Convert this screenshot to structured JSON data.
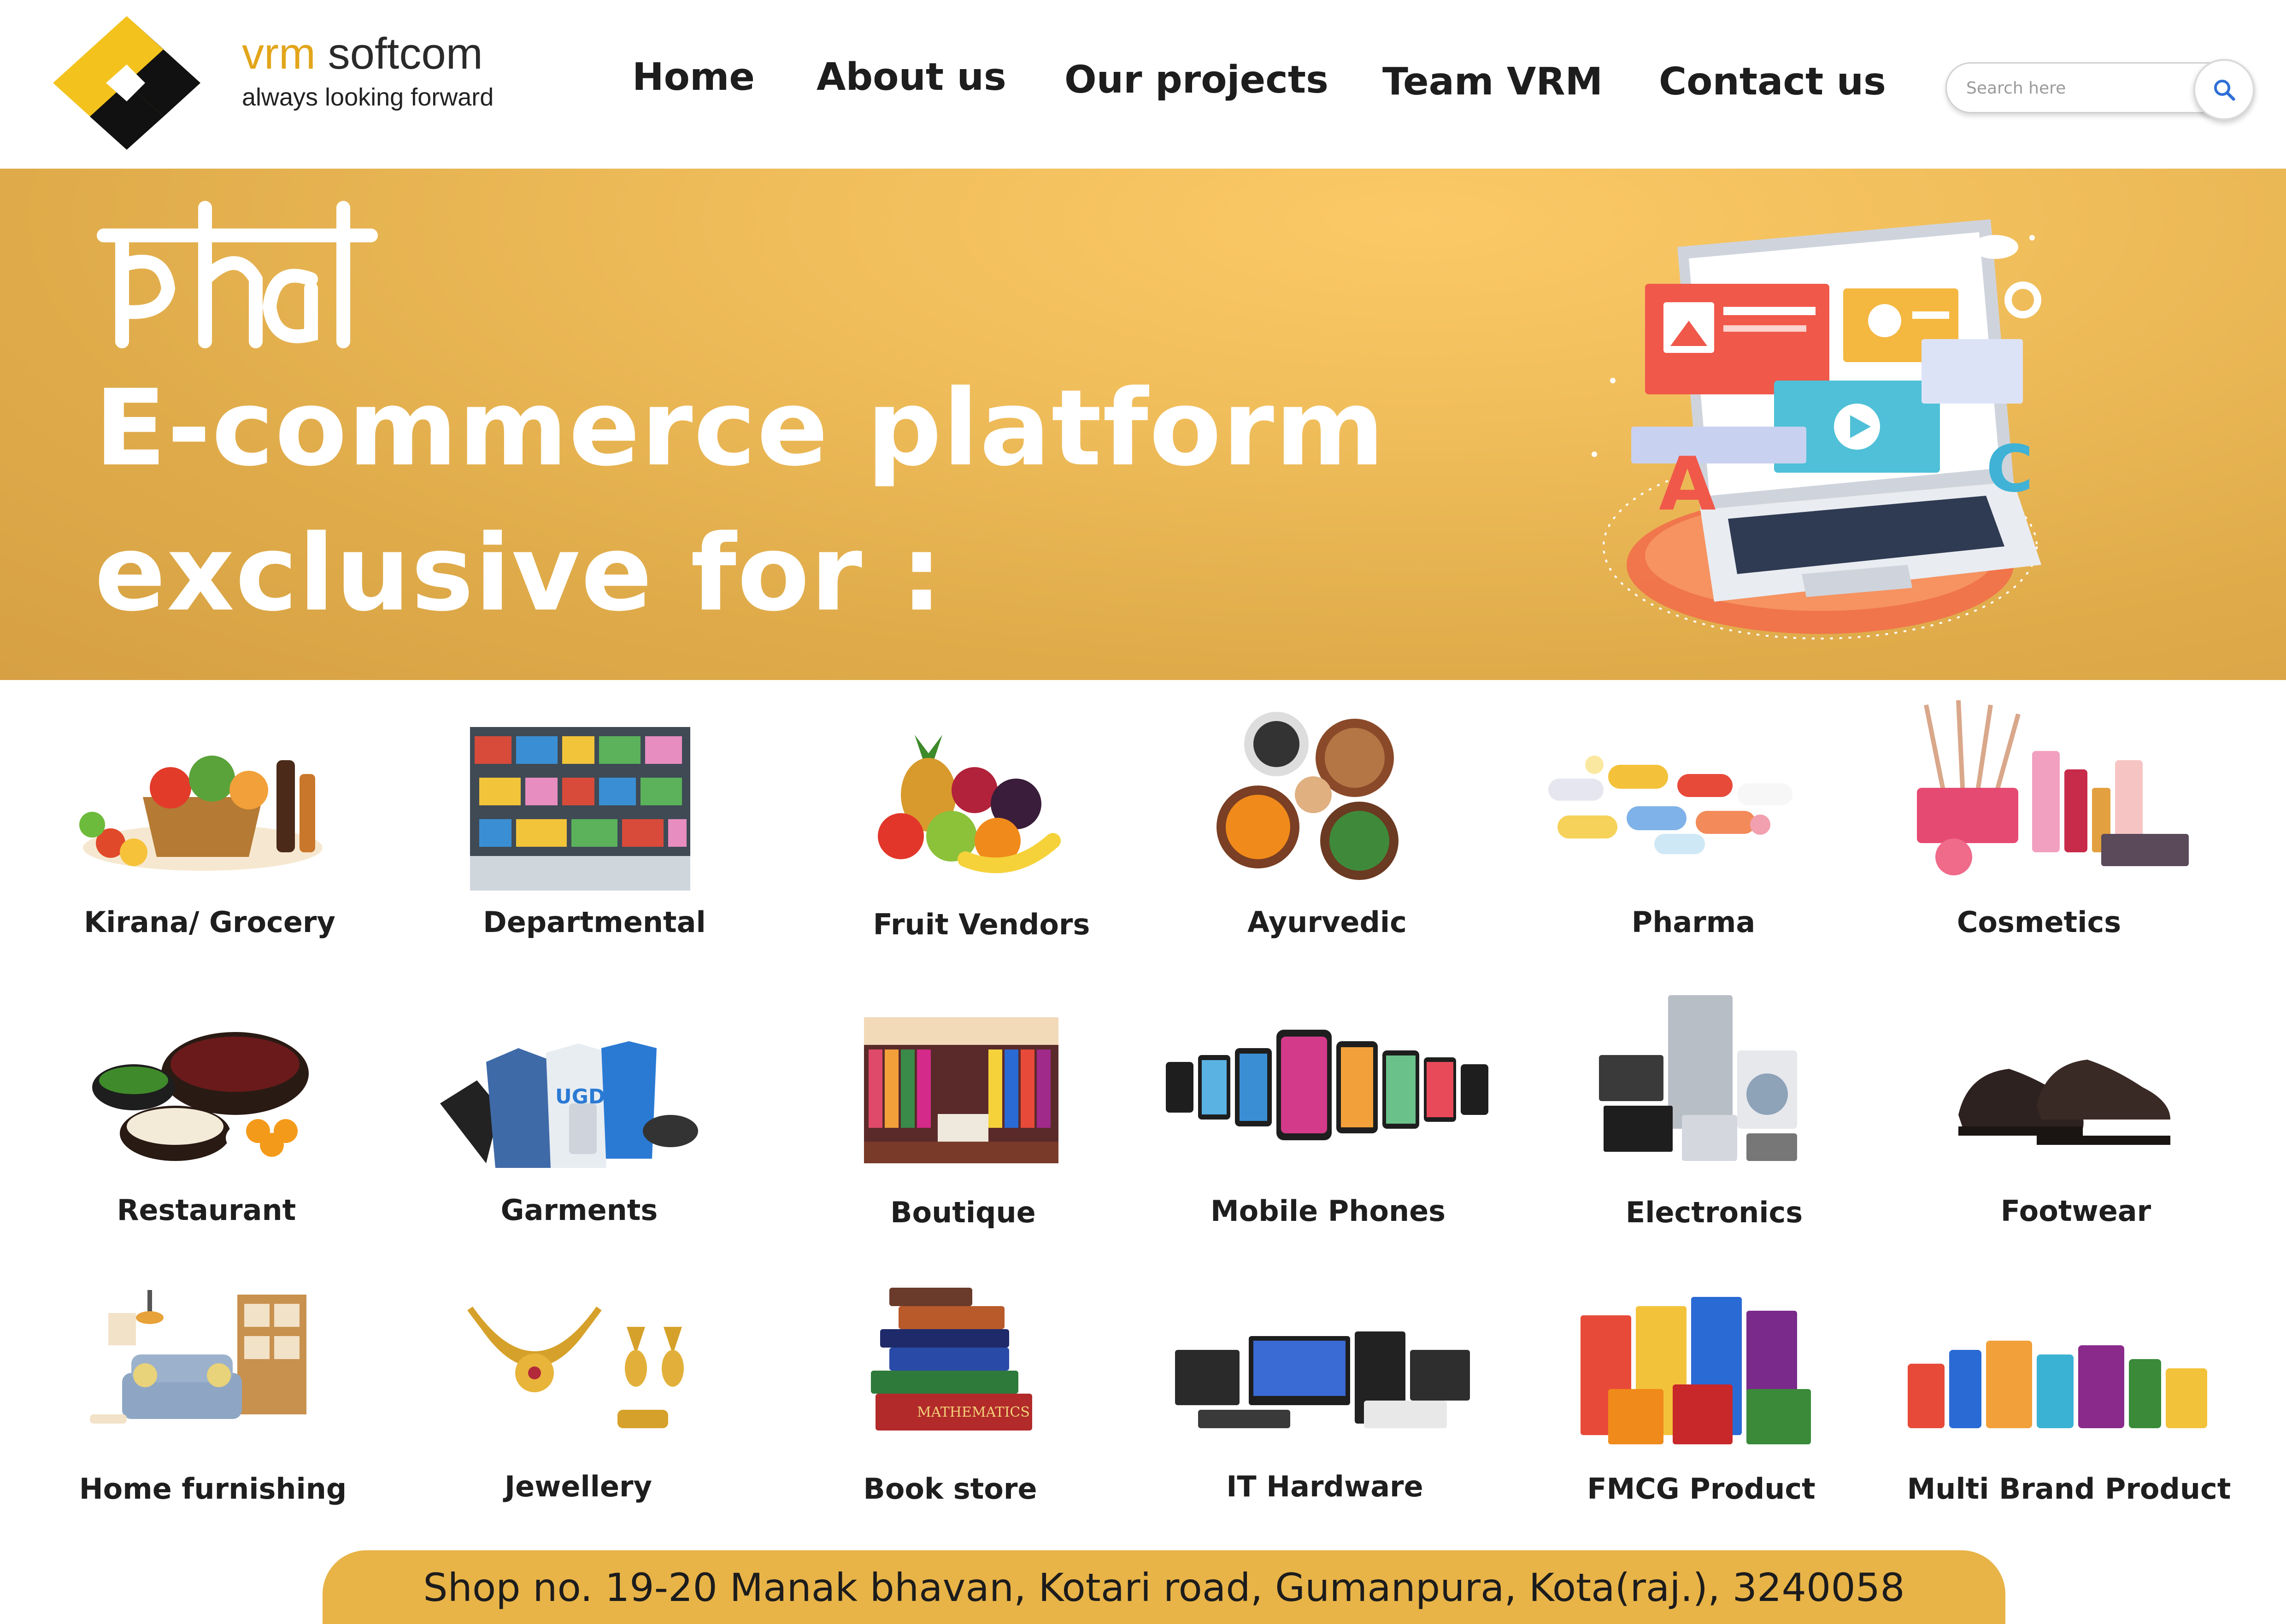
{
  "header": {
    "brand_vrm": "vrm",
    "brand_soft": " softcom",
    "tagline": "always looking forward",
    "logo_colors": [
      "#f3c21d",
      "#111111"
    ],
    "nav": [
      "Home",
      "About us",
      "Our projects",
      "Team VRM",
      "Contact us"
    ],
    "search_placeholder": "Search here",
    "search_icon": "magnifier-icon",
    "accent_color": "#e2a51a"
  },
  "banner": {
    "logo_text": "pehal",
    "line1": "E-commerce platform",
    "line2": "exclusive for :",
    "background_color": "#e2ae4e",
    "illustration": "laptop-ecommerce-illustration"
  },
  "categories": [
    {
      "label": "Kirana/ Grocery",
      "image": "grocery-basket"
    },
    {
      "label": "Departmental",
      "image": "store-shelves"
    },
    {
      "label": "Fruit Vendors",
      "image": "fruit-pile"
    },
    {
      "label": "Ayurvedic",
      "image": "spice-bowls"
    },
    {
      "label": "Pharma",
      "image": "pills"
    },
    {
      "label": "Cosmetics",
      "image": "makeup-set"
    },
    {
      "label": "Restaurant",
      "image": "food-bowls"
    },
    {
      "label": "Garments",
      "image": "apparel-merch"
    },
    {
      "label": "Boutique",
      "image": "boutique-interior"
    },
    {
      "label": "Mobile Phones",
      "image": "smartphones-row"
    },
    {
      "label": "Electronics",
      "image": "home-appliances"
    },
    {
      "label": "Footwear",
      "image": "leather-shoes"
    },
    {
      "label": "Home furnishing",
      "image": "sofa-room"
    },
    {
      "label": "Jewellery",
      "image": "gold-necklace"
    },
    {
      "label": "Book store",
      "image": "book-stack"
    },
    {
      "label": "IT Hardware",
      "image": "computer-hardware"
    },
    {
      "label": "FMCG Product",
      "image": "fmcg-packs"
    },
    {
      "label": "Multi Brand Product",
      "image": "household-products"
    }
  ],
  "footer": {
    "address": "Shop no. 19-20 Manak bhavan, Kotari road, Gumanpura, Kota(raj.), 3240058",
    "background_color": "#e8b347"
  }
}
